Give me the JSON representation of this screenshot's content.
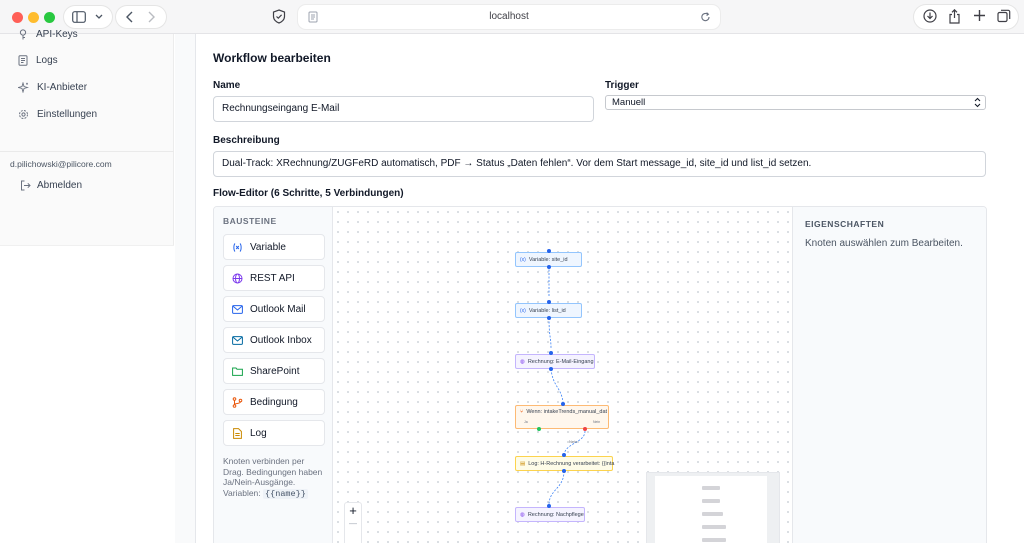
{
  "browser": {
    "url": "localhost"
  },
  "sidebar": {
    "items": [
      {
        "label": "API-Keys",
        "icon": "key-icon"
      },
      {
        "label": "Logs",
        "icon": "logs-icon"
      },
      {
        "label": "KI-Anbieter",
        "icon": "sparkle-icon"
      },
      {
        "label": "Einstellungen",
        "icon": "gear-icon"
      }
    ],
    "user_email": "d.pilichowski@pilicore.com",
    "logout_label": "Abmelden"
  },
  "editor": {
    "title": "Workflow bearbeiten",
    "name_label": "Name",
    "name_value": "Rechnungseingang E-Mail",
    "trigger_label": "Trigger",
    "trigger_value": "Manuell",
    "description_label": "Beschreibung",
    "description_value": "Dual-Track: XRechnung/ZUGFeRD automatisch, PDF → Status „Daten fehlen“. Vor dem Start message_id, site_id und list_id setzen.",
    "flow_label": "Flow-Editor (6 Schritte, 5 Verbindungen)"
  },
  "blocks": {
    "title": "BAUSTEINE",
    "items": [
      {
        "label": "Variable",
        "icon": "variable-icon",
        "color": "#2563eb"
      },
      {
        "label": "REST API",
        "icon": "globe-icon",
        "color": "#7c3aed"
      },
      {
        "label": "Outlook Mail",
        "icon": "mail-icon",
        "color": "#2563eb"
      },
      {
        "label": "Outlook Inbox",
        "icon": "inbox-icon",
        "color": "#0369a1"
      },
      {
        "label": "SharePoint",
        "icon": "folder-icon",
        "color": "#16a34a"
      },
      {
        "label": "Bedingung",
        "icon": "branch-icon",
        "color": "#ea580c"
      },
      {
        "label": "Log",
        "icon": "document-icon",
        "color": "#ca8a04"
      }
    ],
    "help_text": "Knoten verbinden per Drag. Bedingungen haben Ja/Nein-Ausgänge. Variablen:",
    "help_code": "{{name}}"
  },
  "canvas": {
    "nodes": [
      {
        "label": "Variable: site_id",
        "type": "variable"
      },
      {
        "label": "Variable: list_id",
        "type": "variable"
      },
      {
        "label": "Rechnung: E-Mail-Eingang",
        "type": "mail"
      },
      {
        "label": "Wenn: intakeTrends_manual_dat",
        "type": "condition",
        "yes_label": "Ja",
        "no_label": "Nein"
      },
      {
        "label": "Log: H-Rechnung verarbeitet: {{inta",
        "type": "log"
      },
      {
        "label": "Rechnung: Nachpflege",
        "type": "mail"
      }
    ],
    "edge_label_no": "Nein",
    "zoom_in": "+",
    "zoom_out": "—"
  },
  "properties": {
    "title": "EIGENSCHAFTEN",
    "hint": "Knoten auswählen zum Bearbeiten."
  }
}
